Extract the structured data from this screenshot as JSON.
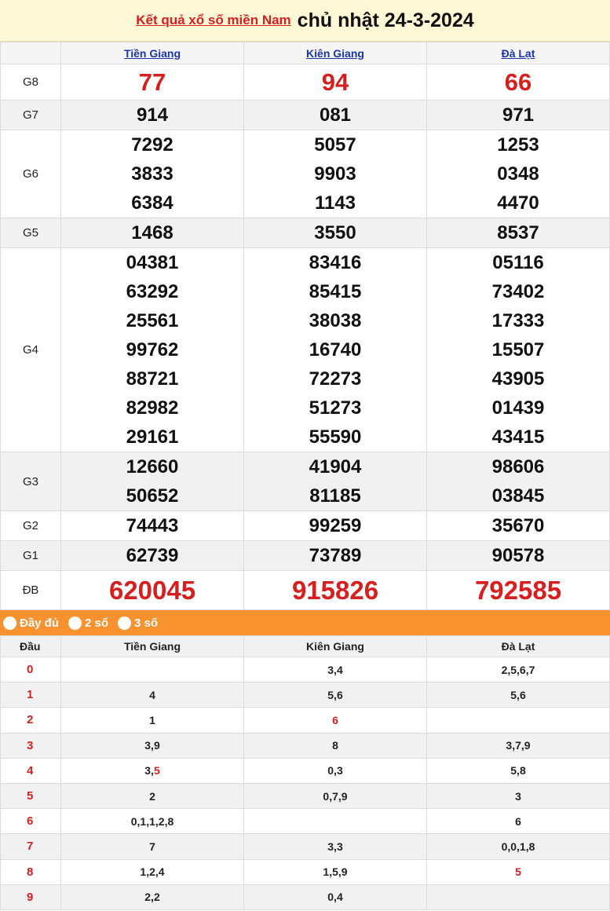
{
  "header": {
    "link_text": "Kết quả xổ số miền Nam",
    "date_text": "chủ nhật 24-3-2024"
  },
  "provinces": [
    "Tiền Giang",
    "Kiên Giang",
    "Đà Lạt"
  ],
  "prizes": [
    {
      "label": "G8",
      "values": [
        [
          "77"
        ],
        [
          "94"
        ],
        [
          "66"
        ]
      ]
    },
    {
      "label": "G7",
      "values": [
        [
          "914"
        ],
        [
          "081"
        ],
        [
          "971"
        ]
      ]
    },
    {
      "label": "G6",
      "values": [
        [
          "7292",
          "3833",
          "6384"
        ],
        [
          "5057",
          "9903",
          "1143"
        ],
        [
          "1253",
          "0348",
          "4470"
        ]
      ]
    },
    {
      "label": "G5",
      "values": [
        [
          "1468"
        ],
        [
          "3550"
        ],
        [
          "8537"
        ]
      ]
    },
    {
      "label": "G4",
      "values": [
        [
          "04381",
          "63292",
          "25561",
          "99762",
          "88721",
          "82982",
          "29161"
        ],
        [
          "83416",
          "85415",
          "38038",
          "16740",
          "72273",
          "51273",
          "55590"
        ],
        [
          "05116",
          "73402",
          "17333",
          "15507",
          "43905",
          "01439",
          "43415"
        ]
      ]
    },
    {
      "label": "G3",
      "values": [
        [
          "12660",
          "50652"
        ],
        [
          "41904",
          "81185"
        ],
        [
          "98606",
          "03845"
        ]
      ]
    },
    {
      "label": "G2",
      "values": [
        [
          "74443"
        ],
        [
          "99259"
        ],
        [
          "35670"
        ]
      ]
    },
    {
      "label": "G1",
      "values": [
        [
          "62739"
        ],
        [
          "73789"
        ],
        [
          "90578"
        ]
      ]
    },
    {
      "label": "ĐB",
      "values": [
        [
          "620045"
        ],
        [
          "915826"
        ],
        [
          "792585"
        ]
      ]
    }
  ],
  "filter_options": [
    "Đầy đủ",
    "2 số",
    "3 số"
  ],
  "heads_table": {
    "col_label": "Đầu",
    "columns": [
      "Tiền Giang",
      "Kiên Giang",
      "Đà Lạt"
    ],
    "rows": [
      {
        "head": "0",
        "cells": [
          "",
          "3,4",
          "2,5,6,7"
        ]
      },
      {
        "head": "1",
        "cells": [
          "4",
          "5,6",
          "5,6"
        ]
      },
      {
        "head": "2",
        "cells": [
          "1",
          "6",
          ""
        ]
      },
      {
        "head": "3",
        "cells": [
          "3,9",
          "8",
          "3,7,9"
        ]
      },
      {
        "head": "4",
        "cells": [
          "3,5",
          "0,3",
          "5,8"
        ]
      },
      {
        "head": "5",
        "cells": [
          "2",
          "0,7,9",
          "3"
        ]
      },
      {
        "head": "6",
        "cells": [
          "0,1,1,2,8",
          "",
          "6"
        ]
      },
      {
        "head": "7",
        "cells": [
          "7",
          "3,3",
          "0,0,1,8"
        ]
      },
      {
        "head": "8",
        "cells": [
          "1,2,4",
          "1,5,9",
          "5"
        ]
      },
      {
        "head": "9",
        "cells": [
          "2,2",
          "0,4",
          ""
        ]
      }
    ],
    "red_tails": {
      "2-1": "6",
      "4-0": "5",
      "8-2": "5"
    }
  },
  "colors": {
    "accent_red": "#d81f1f",
    "filter_orange": "#f7922e",
    "link_blue": "#1a35a8"
  }
}
